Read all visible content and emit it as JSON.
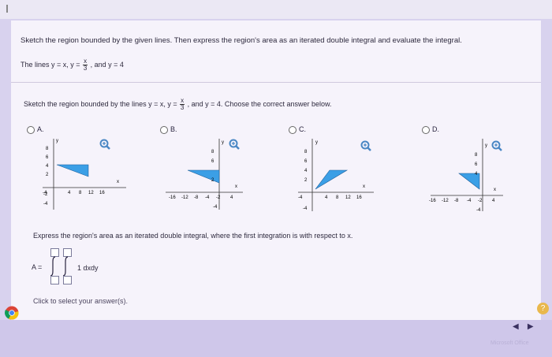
{
  "question": {
    "prompt": "Sketch the region bounded by the given lines. Then express the region's area as an iterated double integral and evaluate the integral.",
    "lines_prefix": "The lines y = x, y =",
    "lines_frac_num": "x",
    "lines_frac_den": "3",
    "lines_suffix": ", and y = 4"
  },
  "part1": {
    "prompt_prefix": "Sketch the region bounded by the lines y = x, y =",
    "frac_num": "x",
    "frac_den": "3",
    "prompt_suffix": ", and y = 4. Choose the correct answer below."
  },
  "choices": [
    {
      "label": "A.",
      "ticks_x": [
        "-4",
        "-2",
        "4",
        "8",
        "12",
        "16"
      ],
      "ticks_y": [
        "8",
        "6",
        "4",
        "2",
        "-2",
        "-4"
      ]
    },
    {
      "label": "B.",
      "ticks_x": [
        "-16",
        "-12",
        "-8",
        "-4",
        "-2",
        "4"
      ],
      "ticks_y": [
        "8",
        "6",
        "4",
        "2",
        "-2",
        "-4"
      ]
    },
    {
      "label": "C.",
      "ticks_x": [
        "-4",
        "-2",
        "4",
        "8",
        "12",
        "16"
      ],
      "ticks_y": [
        "8",
        "6",
        "4",
        "2",
        "-2",
        "-4"
      ]
    },
    {
      "label": "D.",
      "ticks_x": [
        "-16",
        "-12",
        "-8",
        "-4",
        "-2",
        "4"
      ],
      "ticks_y": [
        "8",
        "6",
        "4",
        "2",
        "-2",
        "-4"
      ]
    }
  ],
  "axis": {
    "x": "x",
    "y": "y"
  },
  "part2": {
    "prompt": "Express the region's area as an iterated double integral, where the first integration is with respect to x.",
    "lhs": "A =",
    "integrand": "1 dxdy"
  },
  "footer": {
    "hint": "Click to select your answer(s).",
    "help": "?",
    "watermark": "Microsoft Office"
  },
  "colors": {
    "fill": "#3b9fe6",
    "accent": "#4a87c4"
  }
}
